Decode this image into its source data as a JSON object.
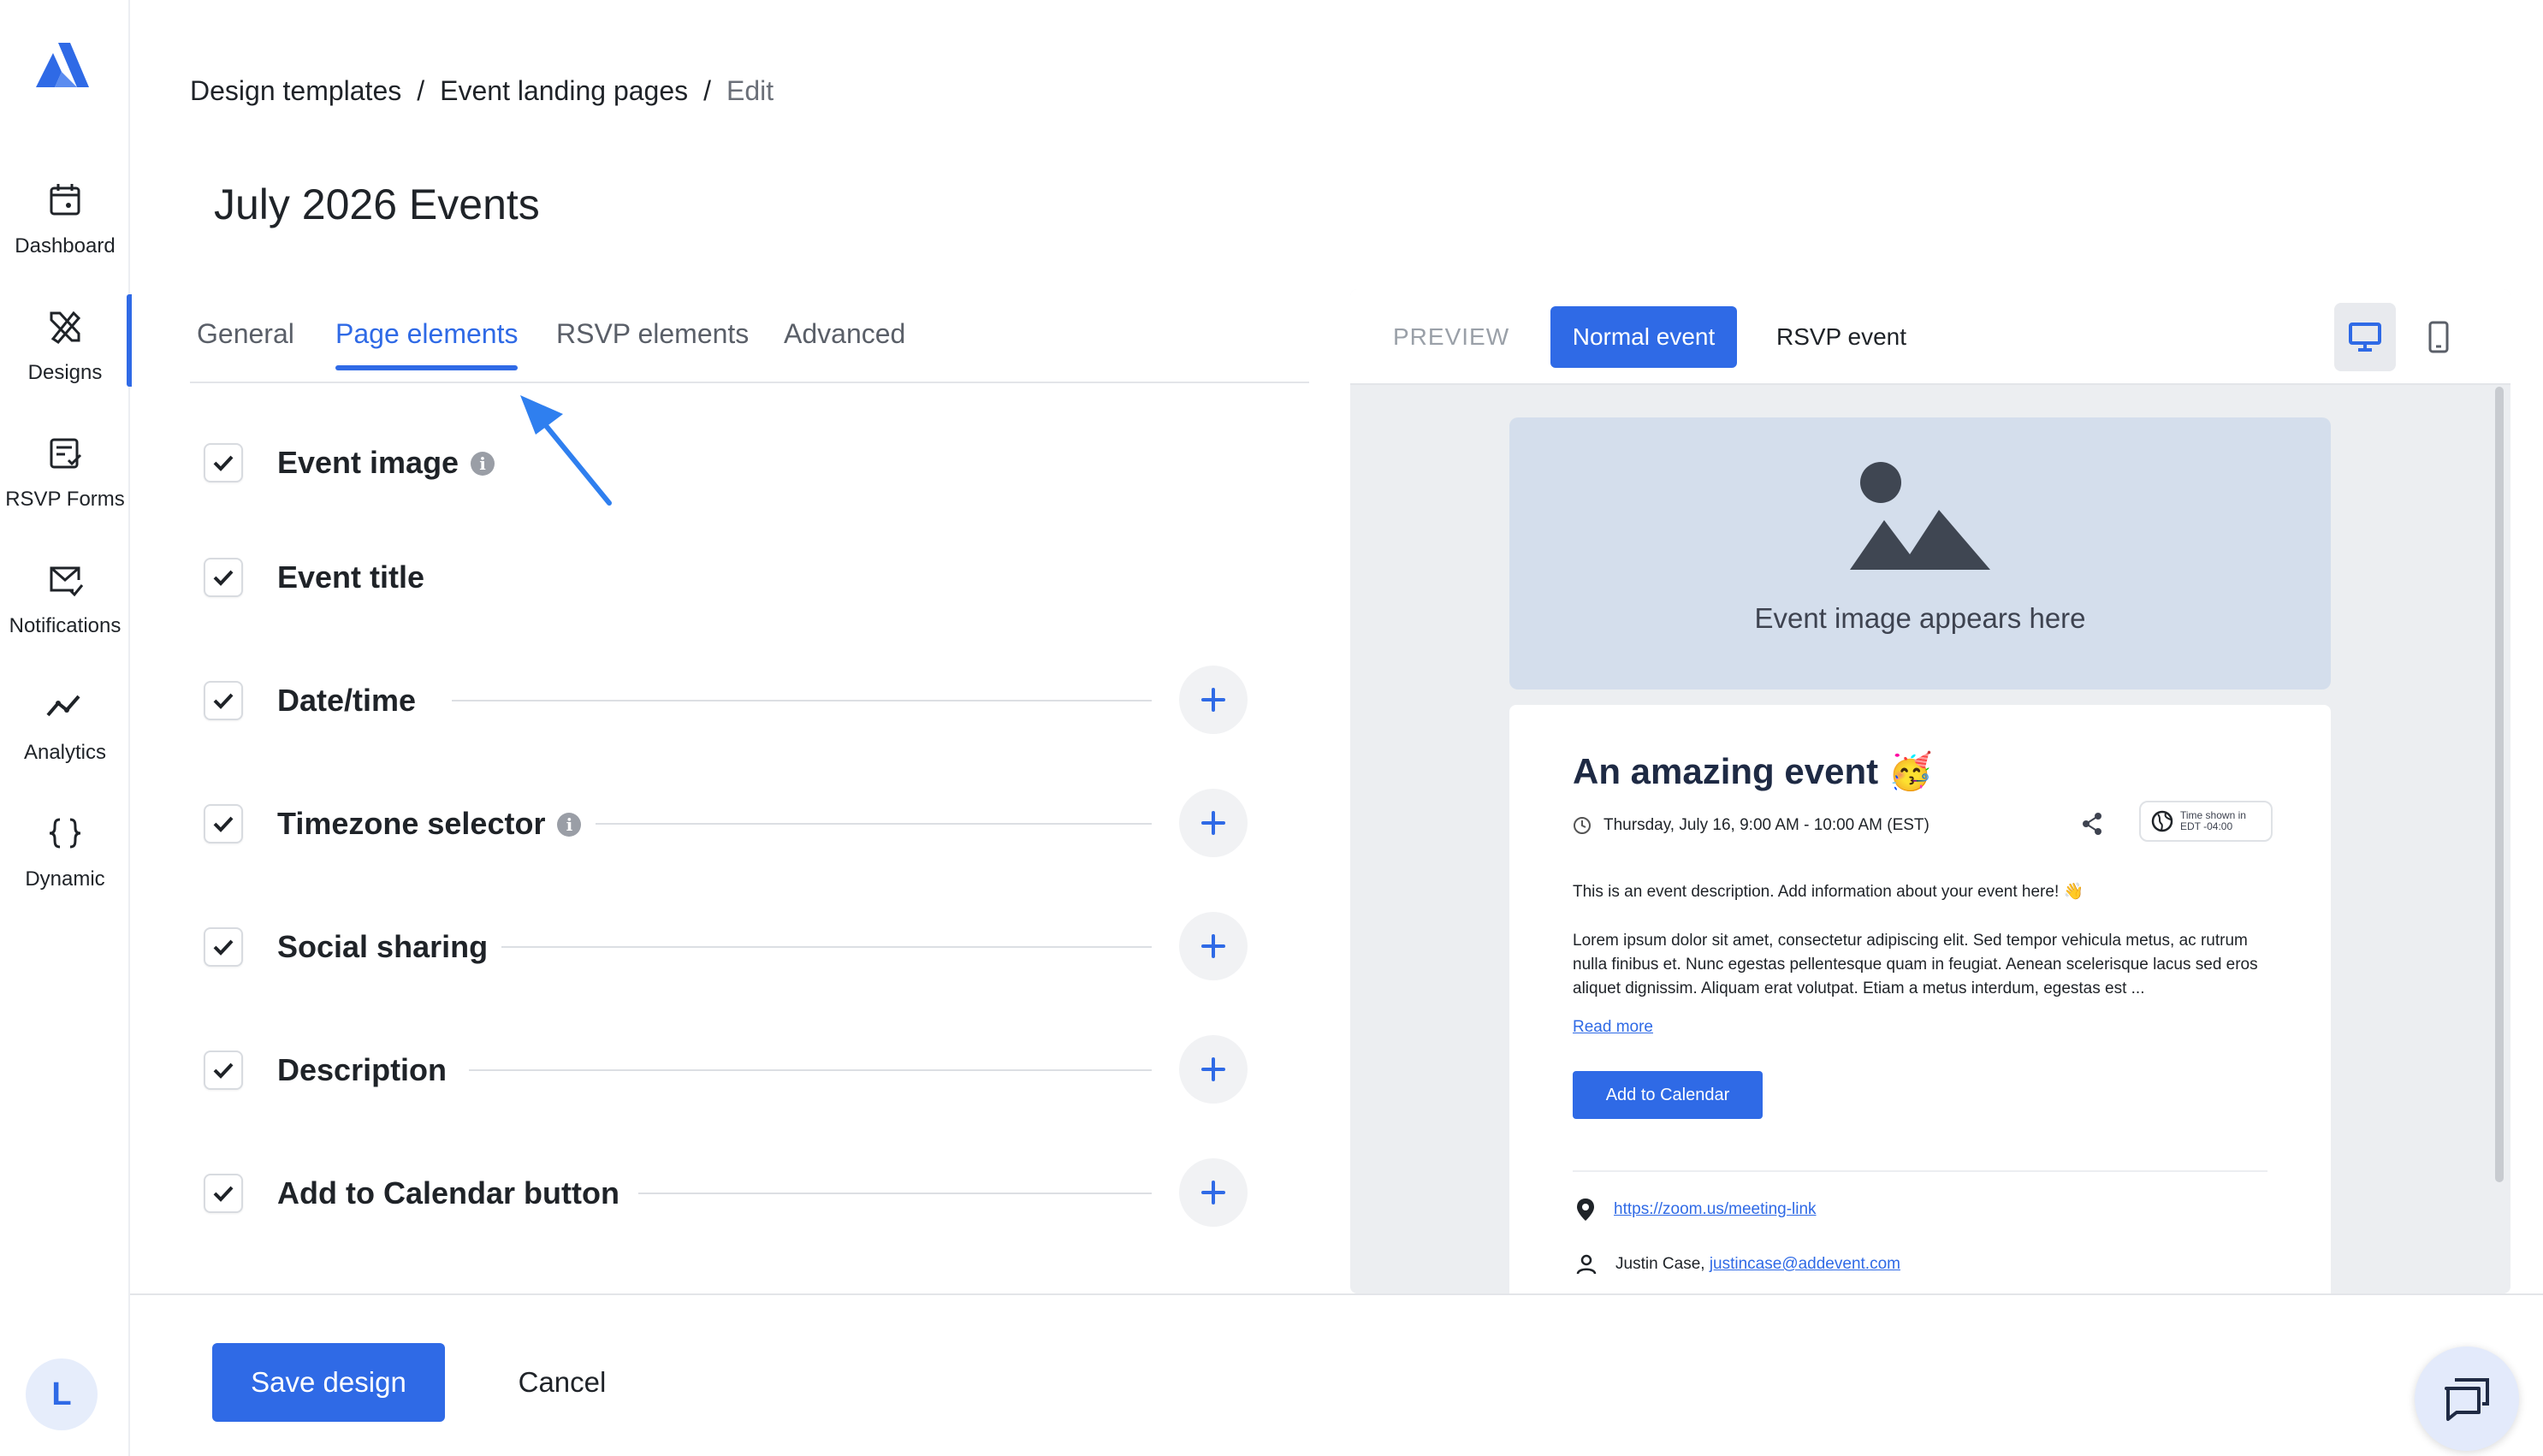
{
  "sidebar": {
    "items": [
      {
        "label": "Dashboard",
        "icon": "calendar-icon"
      },
      {
        "label": "Designs",
        "icon": "designs-icon"
      },
      {
        "label": "RSVP Forms",
        "icon": "rsvp-form-icon"
      },
      {
        "label": "Notifications",
        "icon": "mail-check-icon"
      },
      {
        "label": "Analytics",
        "icon": "analytics-icon"
      },
      {
        "label": "Dynamic",
        "icon": "braces-icon"
      }
    ],
    "active": "Designs",
    "avatar_initial": "L"
  },
  "breadcrumb": {
    "item1": "Design templates",
    "item2": "Event landing pages",
    "item3": "Edit",
    "sep": "/"
  },
  "page_title": "July 2026 Events",
  "tabs": [
    "General",
    "Page elements",
    "RSVP elements",
    "Advanced"
  ],
  "active_tab": "Page elements",
  "elements": [
    {
      "label": "Event image",
      "checked": true,
      "info": true
    },
    {
      "label": "Event title",
      "checked": true
    },
    {
      "label": "Date/time",
      "checked": true
    },
    {
      "label": "Timezone selector",
      "checked": true,
      "info": true
    },
    {
      "label": "Social sharing",
      "checked": true
    },
    {
      "label": "Description",
      "checked": true
    },
    {
      "label": "Add to Calendar button",
      "checked": true
    }
  ],
  "preview": {
    "label": "PREVIEW",
    "normal_event": "Normal event",
    "rsvp_event": "RSVP event",
    "image_placeholder": "Event image appears here",
    "event_title": "An amazing event 🥳",
    "date_time": "Thursday, July 16, 9:00 AM - 10:00 AM (EST)",
    "tz_line1": "Time shown in",
    "tz_line2": "EDT -04:00",
    "description": "This is an event description. Add information about your event here! 👋",
    "lorem": "Lorem ipsum dolor sit amet, consectetur adipiscing elit. Sed tempor vehicula metus, ac rutrum nulla finibus et. Nunc egestas pellentesque quam in feugiat. Aenean scelerisque lacus sed eros aliquet dignissim. Aliquam erat volutpat. Etiam a metus interdum, egestas est ...",
    "read_more": "Read more",
    "add_to_calendar": "Add to Calendar",
    "location_link": "https://zoom.us/meeting-link",
    "organizer_name": "Justin Case,",
    "organizer_email": "justincase@addevent.com"
  },
  "footer": {
    "save": "Save design",
    "cancel": "Cancel"
  },
  "colors": {
    "accent": "#2f6ae6",
    "preview_bg": "#eceef1",
    "placeholder_bg": "#d4deec"
  }
}
